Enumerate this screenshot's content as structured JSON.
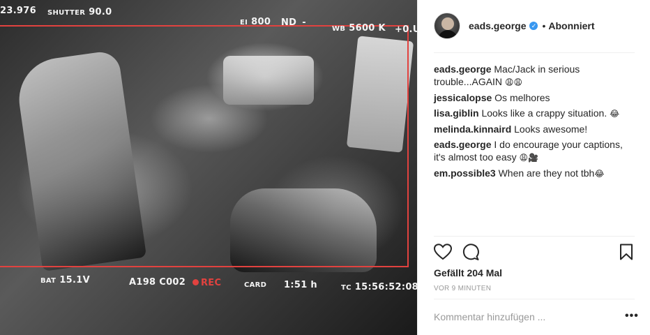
{
  "photo": {
    "hud": {
      "top_left": "23.976",
      "shutter_label": "SHUTTER",
      "shutter_value": "90.0",
      "ei_label": "EI",
      "ei_value": "800",
      "nd_label": "ND",
      "nd_value": "-",
      "wb_label": "WB",
      "wb_value": "5600 K",
      "tint_value": "+0.U",
      "bat_label": "BAT",
      "bat_value": "15.1V",
      "clip": "A198 C002",
      "rec": "REC",
      "card_label": "CARD",
      "card_value": "1:51 h",
      "tc_label": "TC",
      "tc_value": "15:56:52:08"
    },
    "accent_color": "#e2423f"
  },
  "post": {
    "username": "eads.george",
    "verified_icon": "verified-badge-icon",
    "separator": "•",
    "follow_state": "Abonniert",
    "comments": [
      {
        "user": "eads.george",
        "text": "Mac/Jack in serious trouble...AGAIN ",
        "emoji": "😩😩"
      },
      {
        "user": "jessicalopse",
        "text": "Os melhores",
        "emoji": ""
      },
      {
        "user": "lisa.giblin",
        "text": "Looks like a crappy situation. ",
        "emoji": "😂"
      },
      {
        "user": "melinda.kinnaird",
        "text": "Looks awesome!",
        "emoji": ""
      },
      {
        "user": "eads.george",
        "text": "I do encourage your captions, it's almost too easy ",
        "emoji": "😩🎥"
      },
      {
        "user": "em.possible3",
        "text": "When are they not tbh",
        "emoji": "😂"
      }
    ],
    "likes": "Gefällt 204 Mal",
    "time": "VOR 9 MINUTEN",
    "comment_placeholder": "Kommentar hinzufügen ...",
    "more_label": "•••",
    "icons": {
      "like": "heart-icon",
      "comment": "comment-icon",
      "save": "bookmark-icon"
    }
  }
}
